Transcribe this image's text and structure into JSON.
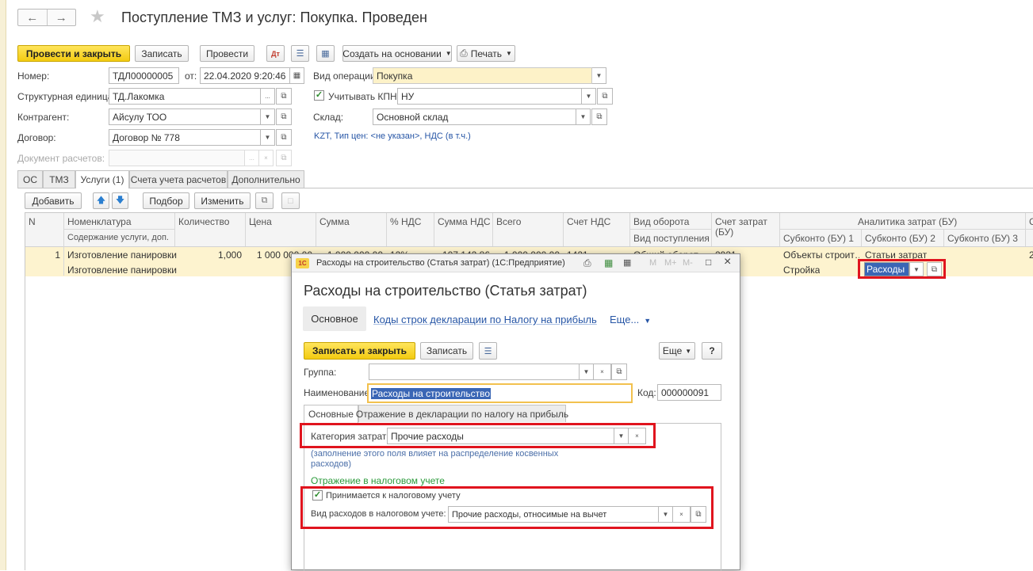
{
  "window": {
    "title": "Поступление ТМЗ и услуг: Покупка. Проведен"
  },
  "toolbar": {
    "post_close": "Провести и закрыть",
    "save": "Записать",
    "post": "Провести",
    "create_based": "Создать на основании",
    "print": "Печать"
  },
  "form": {
    "number_label": "Номер:",
    "number": "ТДЛ00000005",
    "date_label": "от:",
    "date": "22.04.2020  9:20:46",
    "operation_label": "Вид операции:",
    "operation": "Покупка",
    "unit_label": "Структурная единица:",
    "unit": "ТД.Лакомка",
    "kpn_label": "Учитывать КПН",
    "kpn": "НУ",
    "counterparty_label": "Контрагент:",
    "counterparty": "Айсулу ТОО",
    "warehouse_label": "Склад:",
    "warehouse": "Основной склад",
    "contract_label": "Договор:",
    "contract": "Договор № 778",
    "currency_info": "KZT, Тип цен: <не указан>, НДС (в т.ч.)",
    "settlement_doc_label": "Документ расчетов:"
  },
  "tabs": [
    "ОС",
    "ТМЗ",
    "Услуги (1)",
    "Счета учета расчетов",
    "Дополнительно"
  ],
  "table_toolbar": {
    "add": "Добавить",
    "select": "Подбор",
    "change": "Изменить"
  },
  "table": {
    "headers": {
      "n": "N",
      "nomenclature": "Номенклатура",
      "content": "Содержание услуги, доп.",
      "qty": "Количество",
      "price": "Цена",
      "sum": "Сумма",
      "vat_pct": "% НДС",
      "vat_sum": "Сумма НДС",
      "total": "Всего",
      "vat_account": "Счет НДС",
      "turnover": "Вид оборота",
      "receipt": "Вид поступления",
      "cost_account": "Счет затрат",
      "cost_account2": "(БУ)",
      "analytics": "Аналитика затрат (БУ)",
      "sub1": "Субконто (БУ) 1",
      "sub2": "Субконто (БУ) 2",
      "sub3": "Субконто (БУ) 3",
      "extra": "С"
    },
    "row": {
      "n": "1",
      "nomenclature": "Изготовление панировки",
      "content": "Изготовление панировки",
      "qty": "1,000",
      "price": "1 000 000,00",
      "sum": "1 000 000,00",
      "vat_pct": "12%",
      "vat_sum": "107 142,86",
      "total": "1 000 000,00",
      "vat_account": "1421",
      "turnover": "Общий оборот",
      "cost_account": "2931",
      "sub1_line1": "Объекты строит…",
      "sub1_line2": "Стройка",
      "sub2_line1": "Статьи затрат",
      "sub2_value": "Расходы н",
      "extra": "2"
    }
  },
  "popup": {
    "window_title": "Расходы на строительство (Статья затрат)  (1С:Предприятие)",
    "heading": "Расходы на строительство (Статья затрат)",
    "nav_main": "Основное",
    "nav_codes": "Коды строк декларации по Налогу на прибыль",
    "nav_more": "Еще...",
    "save_close": "Записать и закрыть",
    "save": "Записать",
    "more": "Еще",
    "help": "?",
    "group_label": "Группа:",
    "name_label": "Наименование:",
    "name": "Расходы на строительство",
    "code_label": "Код:",
    "code": "000000091",
    "tabs": [
      "Основные",
      "Отражение в декларации по налогу на прибыль"
    ],
    "category_label": "Категория затрат:",
    "category": "Прочие расходы",
    "note": "(заполнение этого поля влияет на распределение косвенных расходов)",
    "tax_section": "Отражение в налоговом учете",
    "tax_accept": "Принимается к налоговому учету",
    "tax_kind_label": "Вид расходов в налоговом учете:",
    "tax_kind": "Прочие расходы, относимые на вычет"
  },
  "colors": {
    "accent_yellow": "#f3cb11",
    "link": "#2756a6",
    "highlight": "#e0141e",
    "row_selected": "#fdf3cf",
    "green_heading": "#2a9a3a"
  }
}
